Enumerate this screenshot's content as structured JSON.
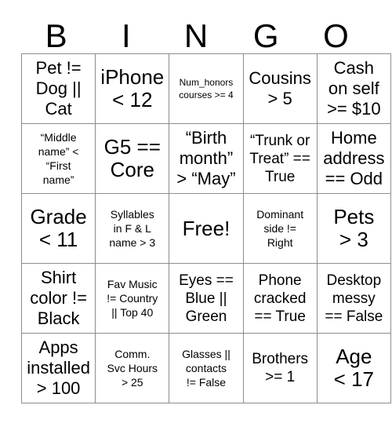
{
  "card": {
    "title": "BINGO",
    "header": [
      {
        "letter": "B"
      },
      {
        "letter": "I"
      },
      {
        "letter": "N"
      },
      {
        "letter": "G"
      },
      {
        "letter": "O"
      }
    ],
    "rows": [
      [
        {
          "text": "Pet !=\nDog ||\nCat",
          "size": "lg"
        },
        {
          "text": "iPhone\n< 12",
          "size": "xl"
        },
        {
          "text": "Num_honors\ncourses >= 4",
          "size": "xs"
        },
        {
          "text": "Cousins\n> 5",
          "size": "lg"
        },
        {
          "text": "Cash\non self\n>= $10",
          "size": "lg"
        }
      ],
      [
        {
          "text": "“Middle\nname” <\n“First\nname”",
          "size": "sm"
        },
        {
          "text": "G5 ==\nCore",
          "size": "xl"
        },
        {
          "text": "“Birth\nmonth”\n> “May”",
          "size": "lg"
        },
        {
          "text": "“Trunk or\nTreat” ==\nTrue",
          "size": "md"
        },
        {
          "text": "Home\naddress\n== Odd",
          "size": "lg"
        }
      ],
      [
        {
          "text": "Grade\n< 11",
          "size": "xl"
        },
        {
          "text": "Syllables\nin F & L\nname > 3",
          "size": "sm"
        },
        {
          "text": "Free!",
          "size": "xl"
        },
        {
          "text": "Dominant\nside !=\nRight",
          "size": "sm"
        },
        {
          "text": "Pets\n> 3",
          "size": "xl"
        }
      ],
      [
        {
          "text": "Shirt\ncolor !=\nBlack",
          "size": "lg"
        },
        {
          "text": "Fav Music\n!= Country\n|| Top 40",
          "size": "sm"
        },
        {
          "text": "Eyes ==\nBlue ||\nGreen",
          "size": "md"
        },
        {
          "text": "Phone\ncracked\n== True",
          "size": "md"
        },
        {
          "text": "Desktop\nmessy\n== False",
          "size": "md"
        }
      ],
      [
        {
          "text": "Apps\ninstalled\n> 100",
          "size": "lg"
        },
        {
          "text": "Comm.\nSvc Hours\n> 25",
          "size": "sm"
        },
        {
          "text": "Glasses ||\ncontacts\n!= False",
          "size": "sm"
        },
        {
          "text": "Brothers\n>= 1",
          "size": "md"
        },
        {
          "text": "Age\n< 17",
          "size": "xl"
        }
      ]
    ],
    "free_space": {
      "row": 2,
      "col": 2,
      "label": "Free!"
    },
    "colors": {
      "background": "#ffffff",
      "text": "#000000",
      "grid_line": "#8c8c8c"
    }
  }
}
